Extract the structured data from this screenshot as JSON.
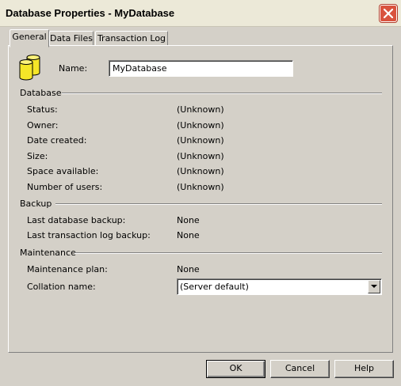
{
  "window": {
    "title": "Database Properties - MyDatabase"
  },
  "tabs": [
    {
      "label": "General"
    },
    {
      "label": "Data Files"
    },
    {
      "label": "Transaction Log"
    }
  ],
  "general": {
    "name_label": "Name:",
    "name_value": "MyDatabase",
    "database": {
      "title": "Database",
      "rows": [
        {
          "label": "Status:",
          "value": "(Unknown)"
        },
        {
          "label": "Owner:",
          "value": "(Unknown)"
        },
        {
          "label": "Date created:",
          "value": "(Unknown)"
        },
        {
          "label": "Size:",
          "value": "(Unknown)"
        },
        {
          "label": "Space available:",
          "value": "(Unknown)"
        },
        {
          "label": "Number of users:",
          "value": "(Unknown)"
        }
      ]
    },
    "backup": {
      "title": "Backup",
      "rows": [
        {
          "label": "Last database backup:",
          "value": "None"
        },
        {
          "label": "Last transaction log backup:",
          "value": "None"
        }
      ]
    },
    "maintenance": {
      "title": "Maintenance",
      "plan_label": "Maintenance plan:",
      "plan_value": "None",
      "collation_label": "Collation name:",
      "collation_value": "(Server default)"
    }
  },
  "buttons": {
    "ok": "OK",
    "cancel": "Cancel",
    "help": "Help"
  },
  "icons": {
    "database": "database-icon",
    "close": "close-icon",
    "dropdown": "chevron-down-icon"
  },
  "colors": {
    "close_button": "#d9533e",
    "icon_yellow": "#f5e628"
  }
}
